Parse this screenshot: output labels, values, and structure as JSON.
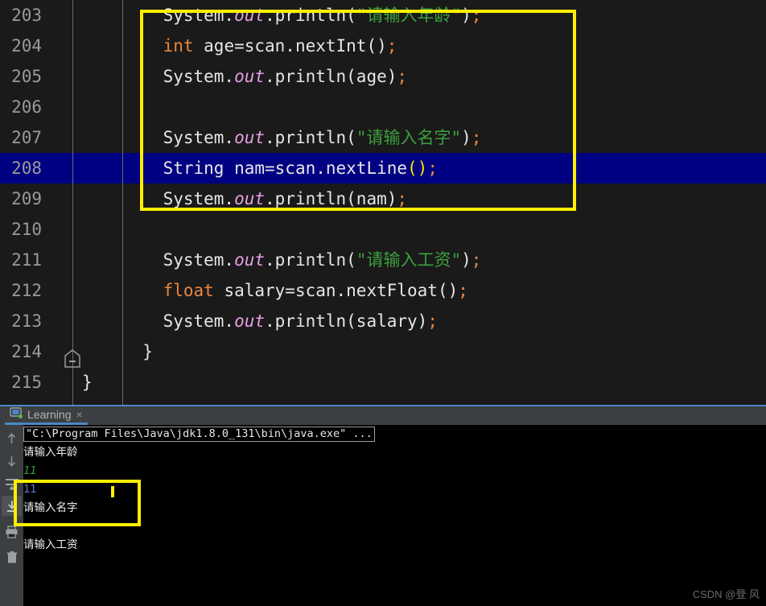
{
  "editor": {
    "lines": [
      {
        "num": "203",
        "tokens": [
          {
            "t": "    System.",
            "c": "plain"
          },
          {
            "t": "out",
            "c": "fld"
          },
          {
            "t": ".println(",
            "c": "plain"
          },
          {
            "t": "\"请输入年龄\"",
            "c": "str"
          },
          {
            "t": ")",
            "c": "plain"
          },
          {
            "t": ";",
            "c": "semi"
          }
        ],
        "current": false
      },
      {
        "num": "204",
        "tokens": [
          {
            "t": "    ",
            "c": "plain"
          },
          {
            "t": "int",
            "c": "kw"
          },
          {
            "t": " age=scan.nextInt()",
            "c": "plain"
          },
          {
            "t": ";",
            "c": "semi"
          }
        ],
        "current": false
      },
      {
        "num": "205",
        "tokens": [
          {
            "t": "    System.",
            "c": "plain"
          },
          {
            "t": "out",
            "c": "fld"
          },
          {
            "t": ".println(age)",
            "c": "plain"
          },
          {
            "t": ";",
            "c": "semi"
          }
        ],
        "current": false
      },
      {
        "num": "206",
        "tokens": [],
        "current": false
      },
      {
        "num": "207",
        "tokens": [
          {
            "t": "    System.",
            "c": "plain"
          },
          {
            "t": "out",
            "c": "fld"
          },
          {
            "t": ".println(",
            "c": "plain"
          },
          {
            "t": "\"请输入名字\"",
            "c": "str"
          },
          {
            "t": ")",
            "c": "plain"
          },
          {
            "t": ";",
            "c": "semi"
          }
        ],
        "current": false
      },
      {
        "num": "208",
        "tokens": [
          {
            "t": "    ",
            "c": "plain"
          },
          {
            "t": "String",
            "c": "plain"
          },
          {
            "t": " nam=scan.nextLine",
            "c": "plain"
          },
          {
            "t": "()",
            "c": "paren-hl"
          },
          {
            "t": ";",
            "c": "semi"
          }
        ],
        "current": true
      },
      {
        "num": "209",
        "tokens": [
          {
            "t": "    System.",
            "c": "plain"
          },
          {
            "t": "out",
            "c": "fld"
          },
          {
            "t": ".println(nam)",
            "c": "plain"
          },
          {
            "t": ";",
            "c": "semi"
          }
        ],
        "current": false
      },
      {
        "num": "210",
        "tokens": [],
        "current": false
      },
      {
        "num": "211",
        "tokens": [
          {
            "t": "    System.",
            "c": "plain"
          },
          {
            "t": "out",
            "c": "fld"
          },
          {
            "t": ".println(",
            "c": "plain"
          },
          {
            "t": "\"请输入工资\"",
            "c": "str"
          },
          {
            "t": ")",
            "c": "plain"
          },
          {
            "t": ";",
            "c": "semi"
          }
        ],
        "current": false
      },
      {
        "num": "212",
        "tokens": [
          {
            "t": "    ",
            "c": "plain"
          },
          {
            "t": "float",
            "c": "kw"
          },
          {
            "t": " salary=scan.nextFloat()",
            "c": "plain"
          },
          {
            "t": ";",
            "c": "semi"
          }
        ],
        "current": false
      },
      {
        "num": "213",
        "tokens": [
          {
            "t": "    System.",
            "c": "plain"
          },
          {
            "t": "out",
            "c": "fld"
          },
          {
            "t": ".println(salary)",
            "c": "plain"
          },
          {
            "t": ";",
            "c": "semi"
          }
        ],
        "current": false
      },
      {
        "num": "214",
        "tokens": [
          {
            "t": "  }",
            "c": "plain"
          }
        ],
        "current": false
      },
      {
        "num": "215",
        "tokens": [
          {
            "t": "}",
            "c": "plain"
          }
        ],
        "current": false,
        "outdent": true
      }
    ],
    "fold_marker": "collapse-fold-icon",
    "annotation_color": "#ffef00",
    "current_line_color": "#000082"
  },
  "tab_strip": {
    "tabs": [
      {
        "label": "Learning",
        "icon": "run-configuration-icon",
        "close": "×",
        "active": true
      }
    ]
  },
  "console": {
    "toolbar_buttons": [
      {
        "name": "scroll-up-icon",
        "glyph": "↑",
        "active": false
      },
      {
        "name": "scroll-down-icon",
        "glyph": "↓",
        "active": false
      },
      {
        "name": "soft-wrap-icon",
        "glyph": "wrap",
        "active": false
      },
      {
        "name": "scroll-to-end-icon",
        "glyph": "end",
        "active": true
      },
      {
        "name": "print-icon",
        "glyph": "print",
        "active": false
      },
      {
        "name": "clear-all-icon",
        "glyph": "trash",
        "active": false
      }
    ],
    "command_line": "\"C:\\Program Files\\Java\\jdk1.8.0_131\\bin\\java.exe\" ...",
    "lines": [
      {
        "text": "请输入年龄",
        "style": "con-white"
      },
      {
        "text": "11",
        "style": "con-input"
      },
      {
        "text": "11",
        "style": "con-blue"
      },
      {
        "text": "请输入名字",
        "style": "con-white"
      },
      {
        "text": "",
        "style": "con-white"
      },
      {
        "text": "请输入工资",
        "style": "con-white"
      }
    ],
    "annotation_color": "#ffef00",
    "caret_color": "#ffef00"
  },
  "watermark": {
    "text": "CSDN @登 风"
  }
}
